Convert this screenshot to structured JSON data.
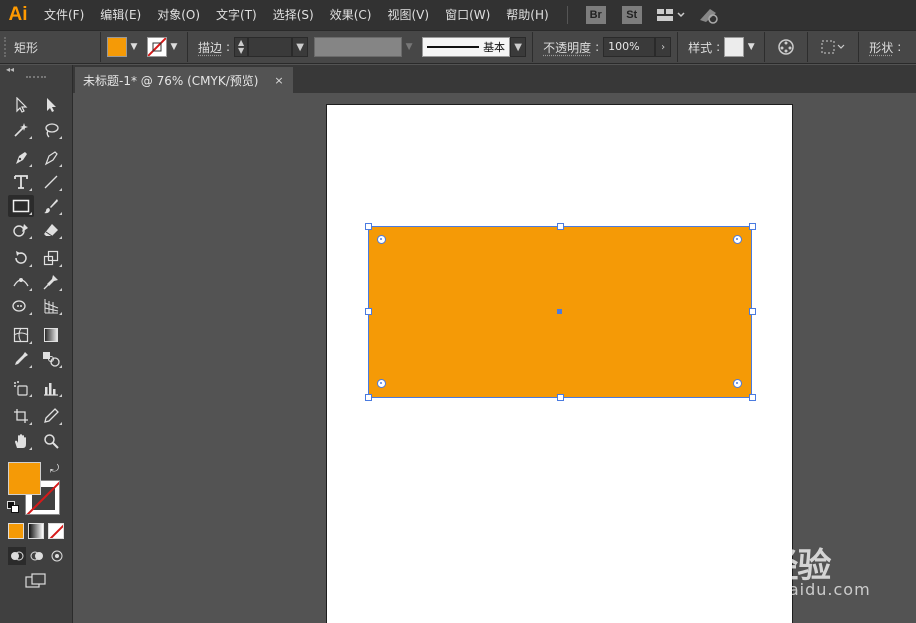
{
  "app": {
    "logo": "Ai",
    "menu": [
      "文件(F)",
      "编辑(E)",
      "对象(O)",
      "文字(T)",
      "选择(S)",
      "效果(C)",
      "视图(V)",
      "窗口(W)",
      "帮助(H)"
    ],
    "bridge_badge": "Br",
    "stock_badge": "St"
  },
  "control_bar": {
    "tool_name": "矩形",
    "stroke_label": "描边",
    "stroke_profile": "基本",
    "opacity_label": "不透明度",
    "opacity_value": "100%",
    "style_label": "样式",
    "shape_label": "形状"
  },
  "document": {
    "tab_title": "未标题-1* @ 76% (CMYK/预览)",
    "close_glyph": "×",
    "zoom_percent": 76,
    "color_mode": "CMYK",
    "view_mode": "预览"
  },
  "tools_panel": {
    "collapse_glyph": "◂◂",
    "fill_color": "#f59a06",
    "stroke_color": "none"
  },
  "selection": {
    "fill_color": "#f59a06",
    "selection_color": "#4a7be0"
  },
  "watermark": {
    "brand": "Bai 经验",
    "url": "jingyan.baidu.com"
  },
  "colors": {
    "menubar": "#323232",
    "controlbar": "#474747",
    "canvas": "#535353",
    "accent": "#ff9a00"
  }
}
